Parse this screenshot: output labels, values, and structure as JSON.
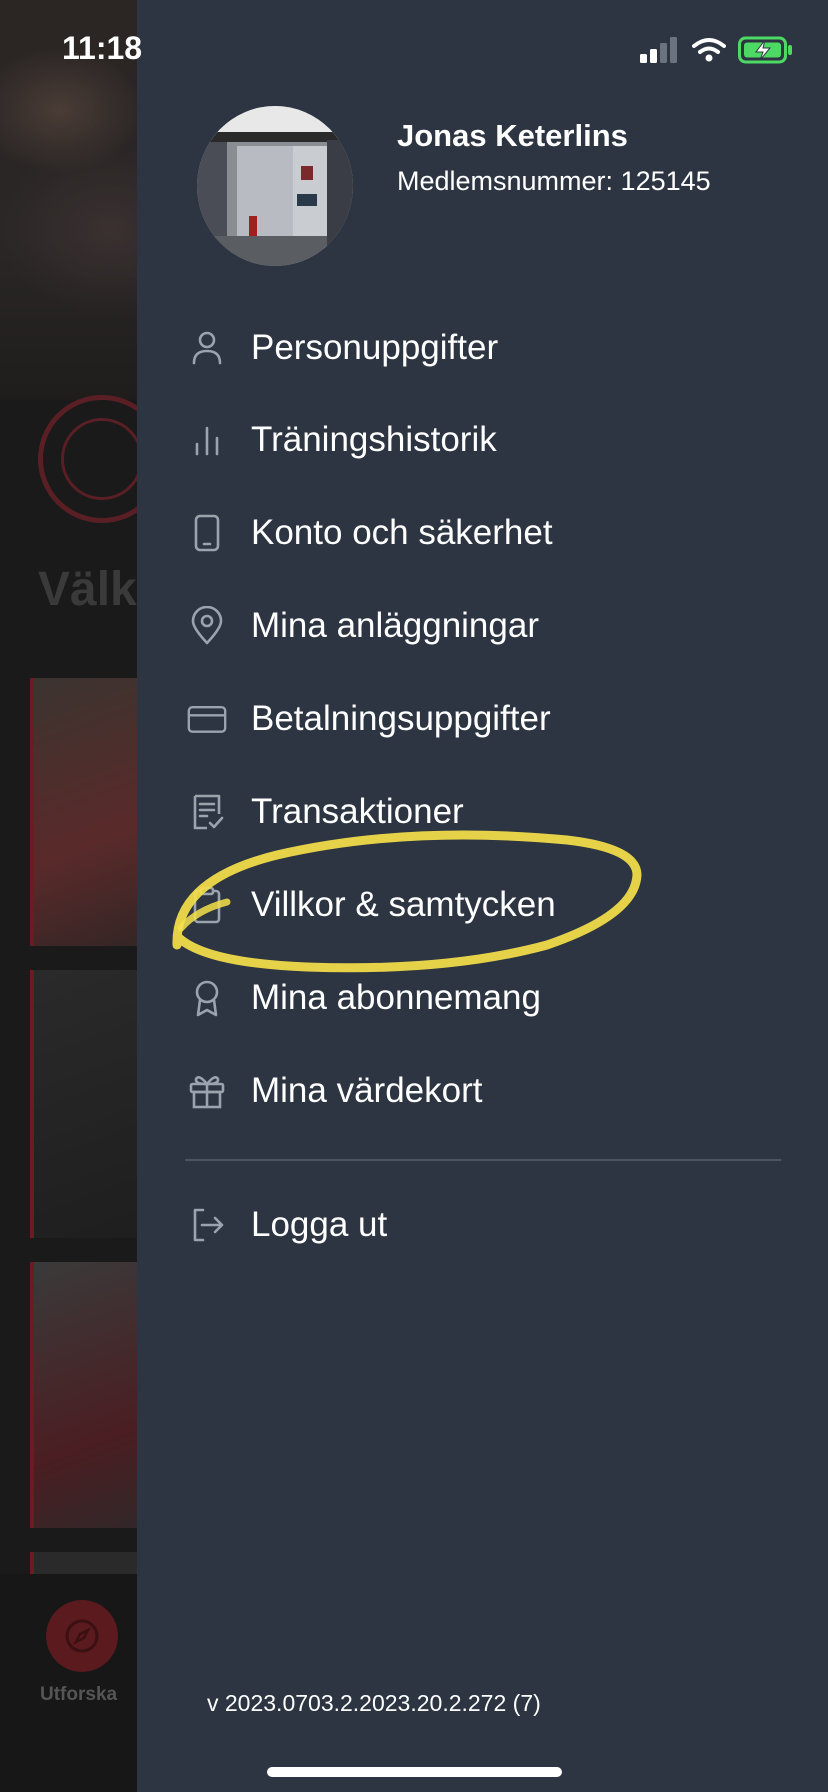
{
  "status_bar": {
    "time": "11:18"
  },
  "background_app": {
    "welcome_text": "Välk",
    "tab_label": "Utforska"
  },
  "drawer": {
    "user": {
      "name": "Jonas Keterlins",
      "member_number": "Medlemsnummer: 125145"
    },
    "menu": [
      {
        "label": "Personuppgifter",
        "icon": "person-icon"
      },
      {
        "label": "Träningshistorik",
        "icon": "bar-chart-icon"
      },
      {
        "label": "Konto och säkerhet",
        "icon": "phone-icon"
      },
      {
        "label": "Mina anläggningar",
        "icon": "location-pin-icon"
      },
      {
        "label": "Betalningsuppgifter",
        "icon": "credit-card-icon"
      },
      {
        "label": "Transaktioner",
        "icon": "receipt-icon"
      },
      {
        "label": "Villkor & samtycken",
        "icon": "clipboard-icon"
      },
      {
        "label": "Mina abonnemang",
        "icon": "award-icon"
      },
      {
        "label": "Mina värdekort",
        "icon": "gift-icon"
      }
    ],
    "logout_label": "Logga ut",
    "version": "v 2023.0703.2.2023.20.2.272 (7)",
    "highlighted_item": "Villkor & samtycken"
  },
  "colors": {
    "drawer_bg": "#2c3541",
    "icon_color": "#9aa3ae",
    "highlight": "#f5e04a",
    "battery": "#4cd964"
  }
}
